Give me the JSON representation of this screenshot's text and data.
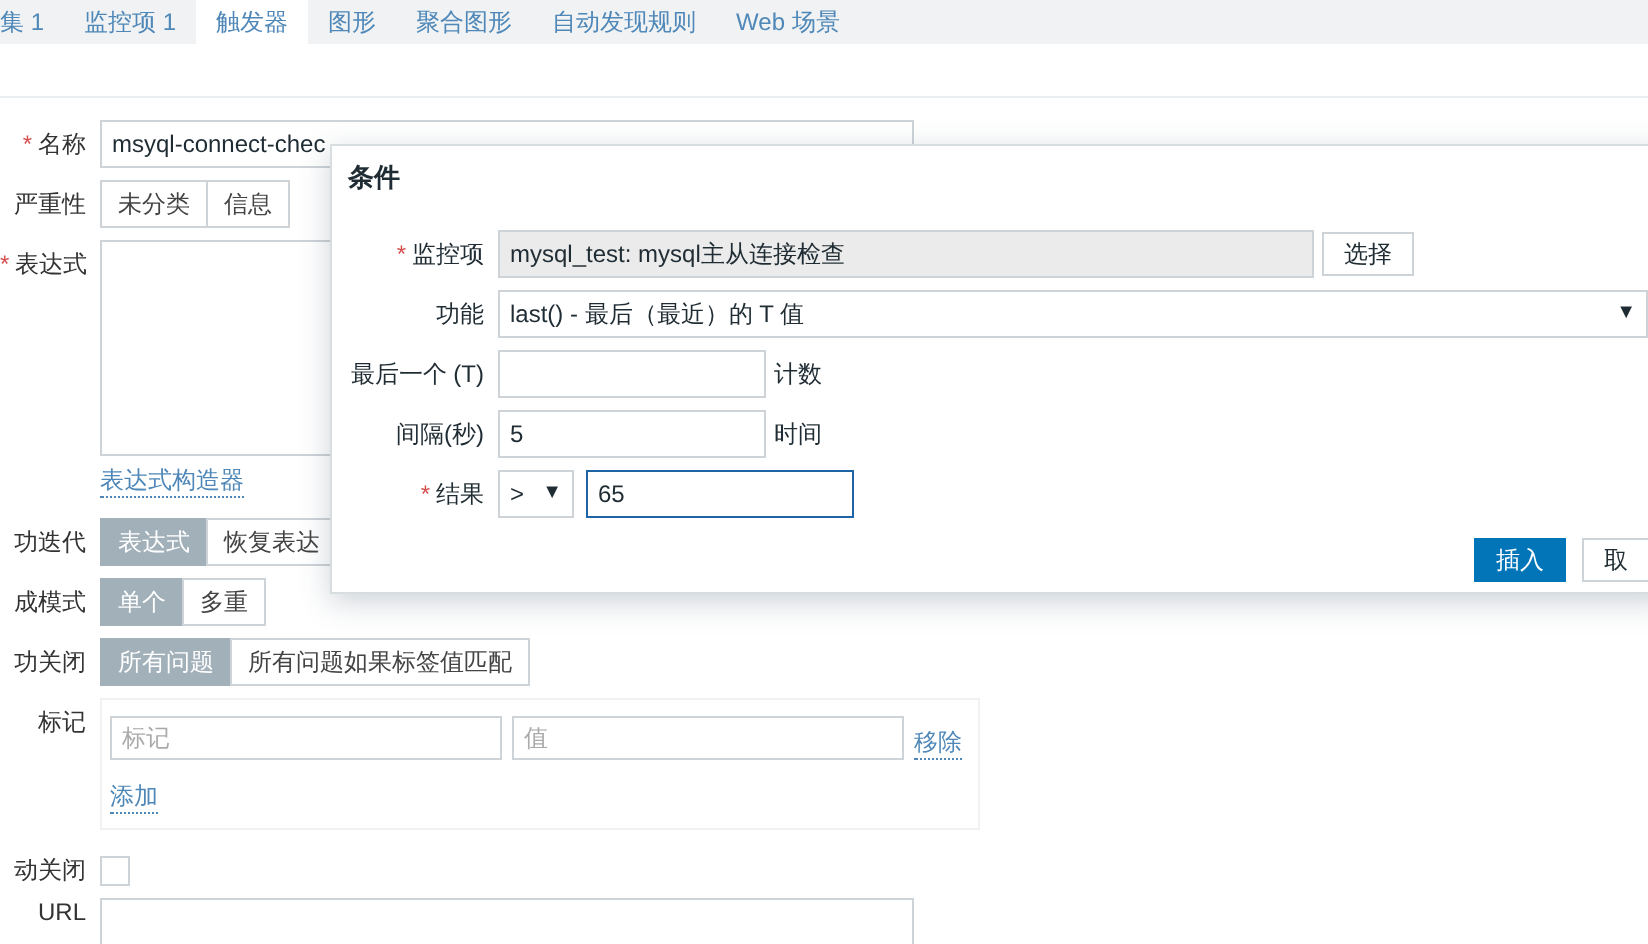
{
  "tabs": [
    {
      "label": "集 1",
      "selected": false
    },
    {
      "label": "监控项 1",
      "selected": false
    },
    {
      "label": "触发器",
      "selected": true
    },
    {
      "label": "图形",
      "selected": false
    },
    {
      "label": "聚合图形",
      "selected": false
    },
    {
      "label": "自动发现规则",
      "selected": false
    },
    {
      "label": "Web 场景",
      "selected": false
    }
  ],
  "form": [
    {
      "kind": "text",
      "asterisk": "*",
      "label": "名称",
      "value": "msyql-connect-chec"
    },
    {
      "kind": "segmented",
      "label": "严重性",
      "options": [
        {
          "label": "未分类",
          "selected": false
        },
        {
          "label": "信息",
          "selected": false
        }
      ]
    },
    {
      "kind": "textarea",
      "asterisk": "*",
      "label": "表达式",
      "link": "表达式构造器"
    },
    {
      "kind": "segmented",
      "label": "功迭代",
      "options": [
        {
          "label": "表达式",
          "selected": true
        },
        {
          "label": "恢复表达",
          "selected": false
        }
      ]
    },
    {
      "kind": "segmented",
      "label": "成模式",
      "options": [
        {
          "label": "单个",
          "selected": true
        },
        {
          "label": "多重",
          "selected": false
        }
      ]
    },
    {
      "kind": "segmented",
      "label": "功关闭",
      "options": [
        {
          "label": "所有问题",
          "selected": true
        },
        {
          "label": "所有问题如果标签值匹配",
          "selected": false
        }
      ]
    },
    {
      "kind": "tags",
      "label": "标记",
      "tag_placeholder": "标记",
      "value_placeholder": "值",
      "remove": "移除",
      "add": "添加"
    },
    {
      "kind": "checkbox",
      "label": "动关闭",
      "checked": false
    },
    {
      "kind": "url",
      "label": "URL"
    }
  ],
  "dialog": {
    "title": "条件",
    "rows": [
      {
        "kind": "item",
        "asterisk": "*",
        "label": "监控项",
        "value": "mysql_test: mysql主从连接检查",
        "button": "选择"
      },
      {
        "kind": "select",
        "label": "功能",
        "value": "last() - 最后（最近）的 T 值",
        "caret": "▼"
      },
      {
        "kind": "input",
        "label": "最后一个 (T)",
        "suffix": "计数"
      },
      {
        "kind": "input",
        "label": "间隔(秒)",
        "value": "5",
        "suffix": "时间"
      },
      {
        "kind": "result",
        "asterisk": "*",
        "label": "结果",
        "operator": ">",
        "caret": "▼",
        "value": "65",
        "focused": true
      }
    ],
    "buttons": [
      {
        "label": "插入",
        "primary": true
      },
      {
        "label": "取",
        "primary": false
      }
    ]
  }
}
